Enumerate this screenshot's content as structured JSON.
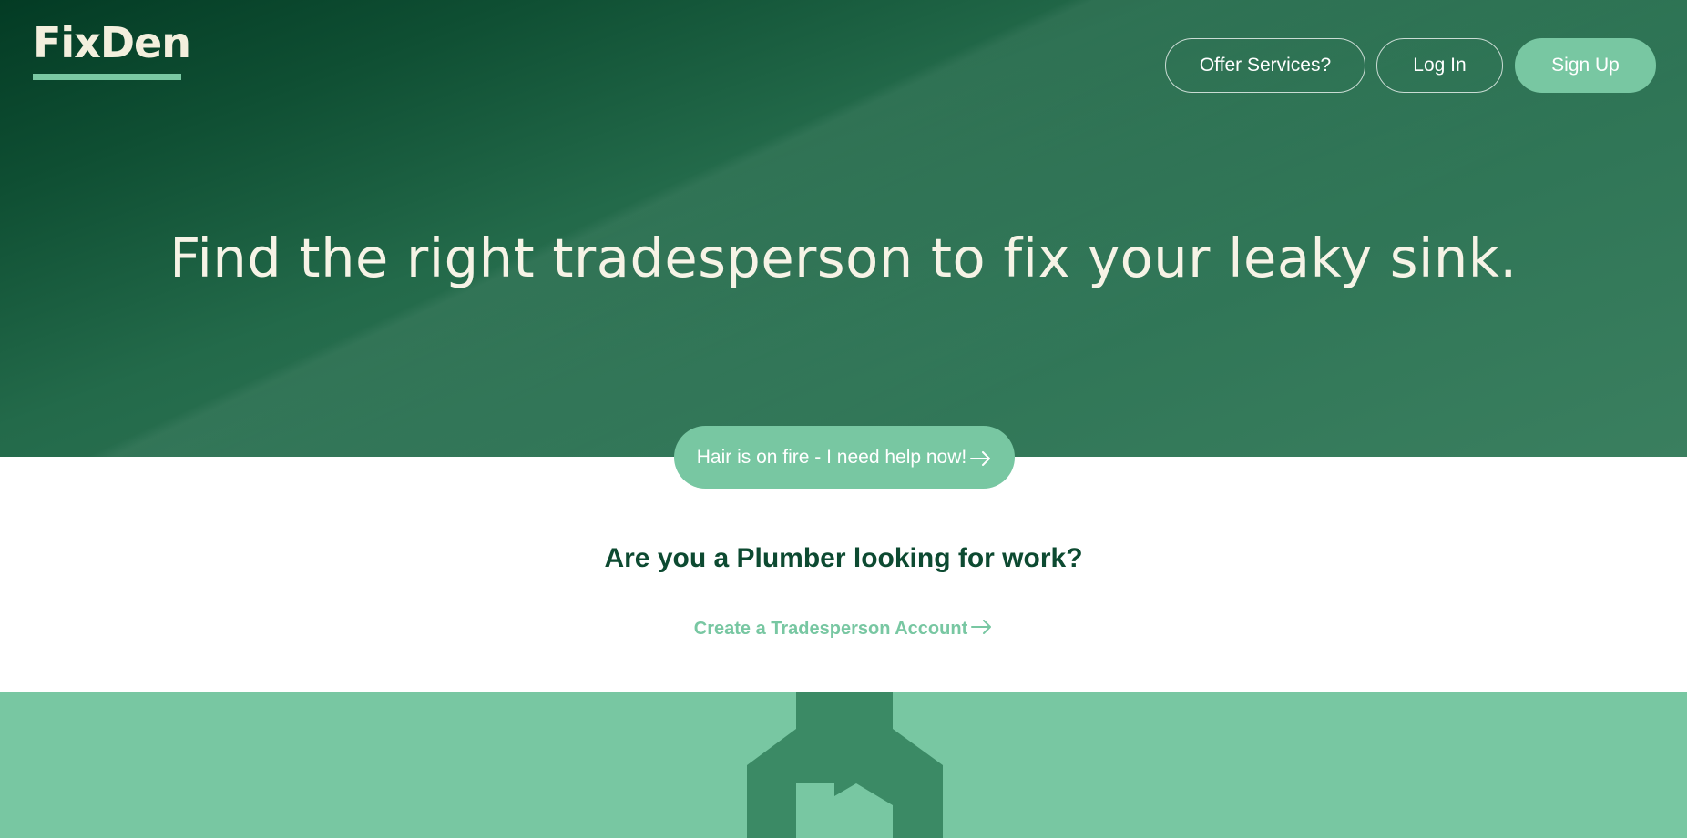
{
  "brand": {
    "name": "FixDen"
  },
  "nav": {
    "offer_services": "Offer Services?",
    "log_in": "Log In",
    "sign_up": "Sign Up"
  },
  "hero": {
    "headline": "Find the right tradesperson to fix your leaky sink.",
    "urgent_cta": "Hair is on fire - I need help now!"
  },
  "trades": {
    "question": "Are you a Plumber looking for work?",
    "create_account": "Create a Tradesperson Account"
  },
  "icons": {
    "arrow": "arrow-right-icon",
    "footer_graphic": "wrench-house-icon"
  },
  "colors": {
    "hero_dark": "#033b24",
    "hero_light": "#3a7f5f",
    "accent": "#78c7a2",
    "heading": "#0d4a31",
    "logo": "#f3efdd",
    "footer_shape": "#3b8a65"
  }
}
